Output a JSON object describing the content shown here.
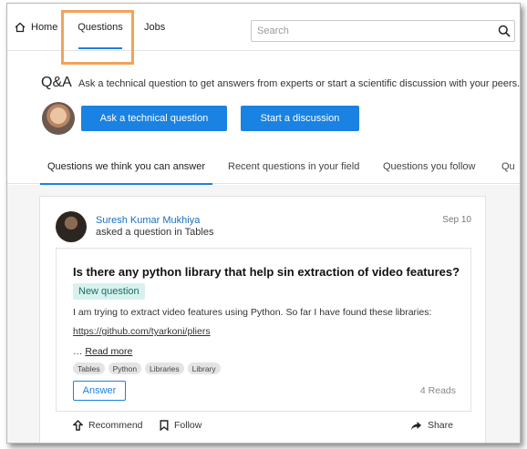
{
  "nav": {
    "home": "Home",
    "questions": "Questions",
    "jobs": "Jobs",
    "search_placeholder": "Search"
  },
  "intro": {
    "title": "Q&A",
    "description": "Ask a technical question to get answers from experts or start a scientific discussion with your peers.",
    "ask_button": "Ask a technical question",
    "discussion_button": "Start a discussion"
  },
  "tabs": [
    {
      "label": "Questions we think you can answer",
      "active": true
    },
    {
      "label": "Recent questions in your field",
      "active": false
    },
    {
      "label": "Questions you follow",
      "active": false
    },
    {
      "label": "Qu",
      "active": false
    }
  ],
  "post": {
    "author": "Suresh Kumar Mukhiya",
    "action": "asked a question in Tables",
    "date": "Sep 10",
    "title": "Is there any python library that help sin extraction of video features?",
    "badge": "New question",
    "body": "I am trying to extract video features using Python. So far I have found these libraries:",
    "link": "https://github.com/tyarkoni/pliers",
    "ellipsis": "…",
    "read_more": "Read more",
    "tags": [
      "Tables",
      "Python",
      "Libraries",
      "Library"
    ],
    "answer_button": "Answer",
    "reads": "4 Reads"
  },
  "actions": {
    "recommend": "Recommend",
    "follow": "Follow",
    "share": "Share"
  },
  "colors": {
    "accent": "#1a82e2",
    "highlight": "#f2a25c",
    "badge_bg": "#d7f2ee"
  }
}
